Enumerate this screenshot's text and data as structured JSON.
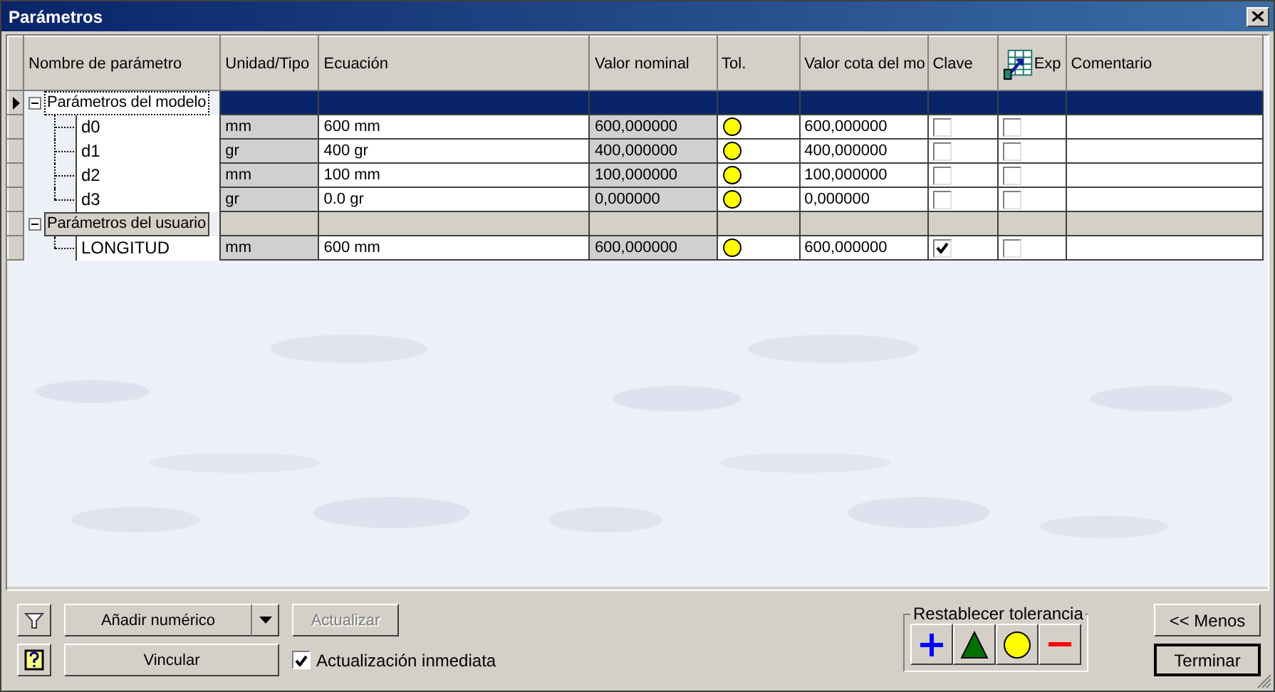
{
  "window": {
    "title": "Parámetros"
  },
  "table": {
    "columns": [
      "Nombre de parámetro",
      "Unidad/Tipo",
      "Ecuación",
      "Valor nominal",
      "Tol.",
      "Valor cota del mo",
      "Clave",
      "Exp",
      "Comentario"
    ],
    "groups": [
      {
        "label": "Parámetros del modelo",
        "selected": true,
        "expanded": true,
        "children": [
          {
            "name": "d0",
            "unit": "mm",
            "equation": "600 mm",
            "nominal": "600,000000",
            "tolerance": {
              "kind": "mid"
            },
            "model_value": "600,000000",
            "key": false,
            "export": false
          },
          {
            "name": "d1",
            "unit": "gr",
            "equation": "400 gr",
            "nominal": "400,000000",
            "tolerance": {
              "kind": "mid"
            },
            "model_value": "400,000000",
            "key": false,
            "export": false
          },
          {
            "name": "d2",
            "unit": "mm",
            "equation": "100 mm",
            "nominal": "100,000000",
            "tolerance": {
              "kind": "mid"
            },
            "model_value": "100,000000",
            "key": false,
            "export": false
          },
          {
            "name": "d3",
            "unit": "gr",
            "equation": "0.0 gr",
            "nominal": "0,000000",
            "tolerance": {
              "kind": "mid"
            },
            "model_value": "0,000000",
            "key": false,
            "export": false
          }
        ]
      },
      {
        "label": "Parámetros del usuario",
        "selected": false,
        "expanded": true,
        "children": [
          {
            "name": "LONGITUD",
            "unit": "mm",
            "equation": "600 mm",
            "nominal": "600,000000",
            "tolerance": {
              "kind": "mid"
            },
            "model_value": "600,000000",
            "key": true,
            "export": false
          }
        ]
      }
    ]
  },
  "buttons": {
    "add": "Añadir numérico",
    "update": {
      "label": "Actualizar",
      "disabled": true
    },
    "link": "Vincular",
    "immediate": {
      "label": "Actualización inmediata",
      "checked": true
    },
    "less": "<< Menos",
    "finish": "Terminar"
  },
  "reset_tolerance": {
    "title": "Restablecer tolerancia",
    "options": [
      {
        "kind": "upper"
      },
      {
        "kind": "median"
      },
      {
        "kind": "mid"
      },
      {
        "kind": "lower"
      }
    ]
  }
}
